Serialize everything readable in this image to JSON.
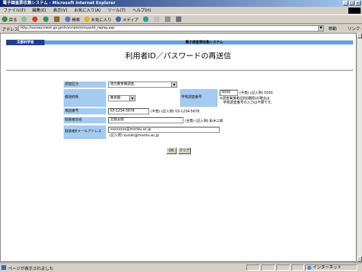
{
  "window": {
    "title": "電子調査票収集システム - Microsoft Internet Explorer",
    "ctrl_min": "_",
    "ctrl_max": "□",
    "ctrl_close": "×"
  },
  "menu": [
    "ファイル(F)",
    "編集(E)",
    "表示(V)",
    "お気に入り(A)",
    "ツール(T)",
    "ヘルプ(H)"
  ],
  "toolbar": {
    "back": "戻る",
    "search": "検索",
    "favorites": "お気に入り",
    "media": "メディア"
  },
  "address": {
    "label": "アドレス(D)",
    "url": "http://survey.mext.go.jp/ck/scripts/ninsyo/id_replay.asp",
    "go": "移動",
    "links": "リンク »"
  },
  "page": {
    "ministry": "文部科学省",
    "system_name": "電子調査票収集システム",
    "title": "利用者ID／パスワードの再送信"
  },
  "form": {
    "survey_type_label": "調査区分",
    "survey_type_value": "地方教育費調査",
    "prefecture_label": "都道府県",
    "prefecture_value": "東京都",
    "school_code_label": "学校調査番号",
    "school_code_value": "0000",
    "school_code_hint": "(半角) (記入例) 5550",
    "school_code_note1": "※調査実施者(回収期間)の場合は",
    "school_code_note2": "学校調査番号の入力は不要です。",
    "phone_label": "電話番号",
    "phone_value": "03-1234-5678",
    "phone_hint": "(半角) (記入例) 03-1234-5678",
    "name_label": "取扱者氏名",
    "name_value": "文部太郎",
    "name_hint": "(全角) (記入例) 鈴木三郎",
    "email_label": "取扱者Eメールアドレス",
    "email_value": "xxxxxxxx@monbu.ac.jp",
    "email_hint": "(記入例) suzuki@monbu.ac.jp",
    "ok_label": "OK",
    "clear_label": "クリア",
    "dropdown_arrow": "▼"
  },
  "status": {
    "text": "ページが表示されました",
    "zone": "インターネット"
  }
}
